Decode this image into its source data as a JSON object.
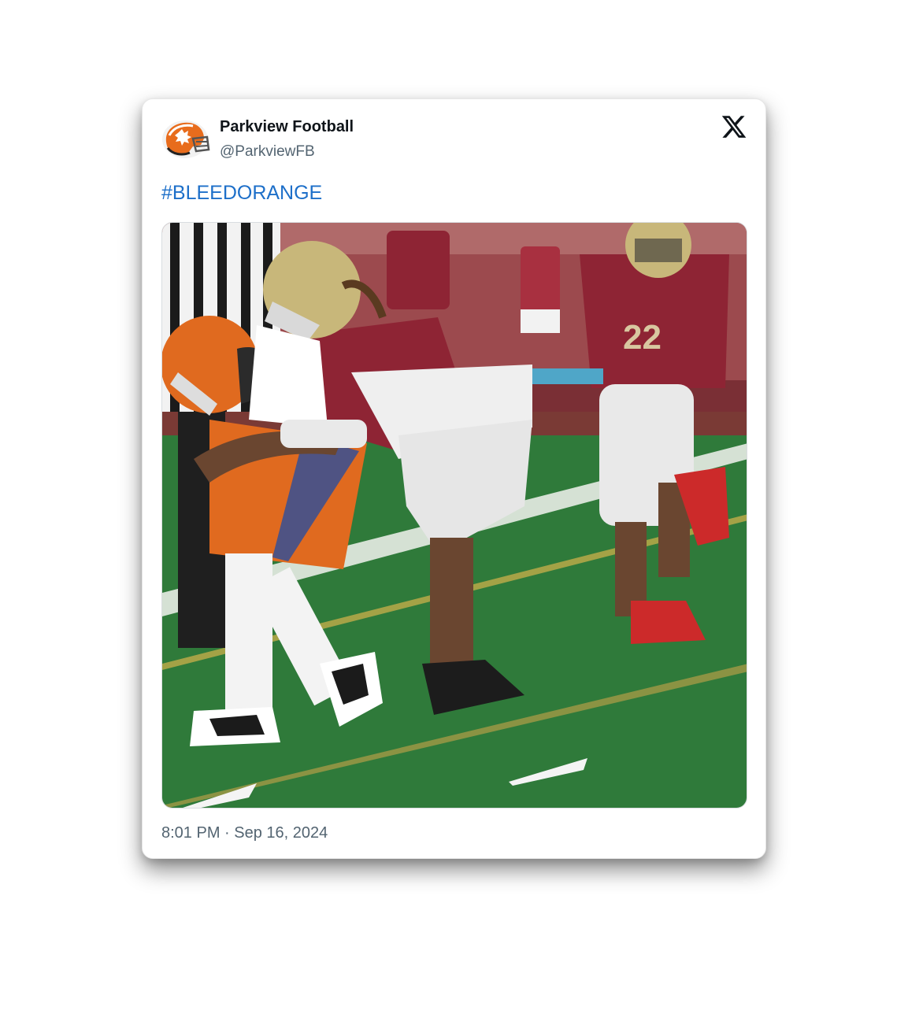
{
  "tweet": {
    "display_name": "Parkview Football",
    "handle": "@ParkviewFB",
    "text": "#BLEEDORANGE",
    "timestamp": "8:01 PM · Sep 16, 2024",
    "photo_alt": "Football players in orange and maroon jerseys during a tackle"
  },
  "icons": {
    "avatar": "orange-football-helmet-icon",
    "platform": "x-logo-icon"
  },
  "colors": {
    "hashtag": "#1d6fc9",
    "name": "#0f1419",
    "muted": "#536471",
    "accent_orange": "#e06a1f",
    "maroon": "#8e2434"
  }
}
